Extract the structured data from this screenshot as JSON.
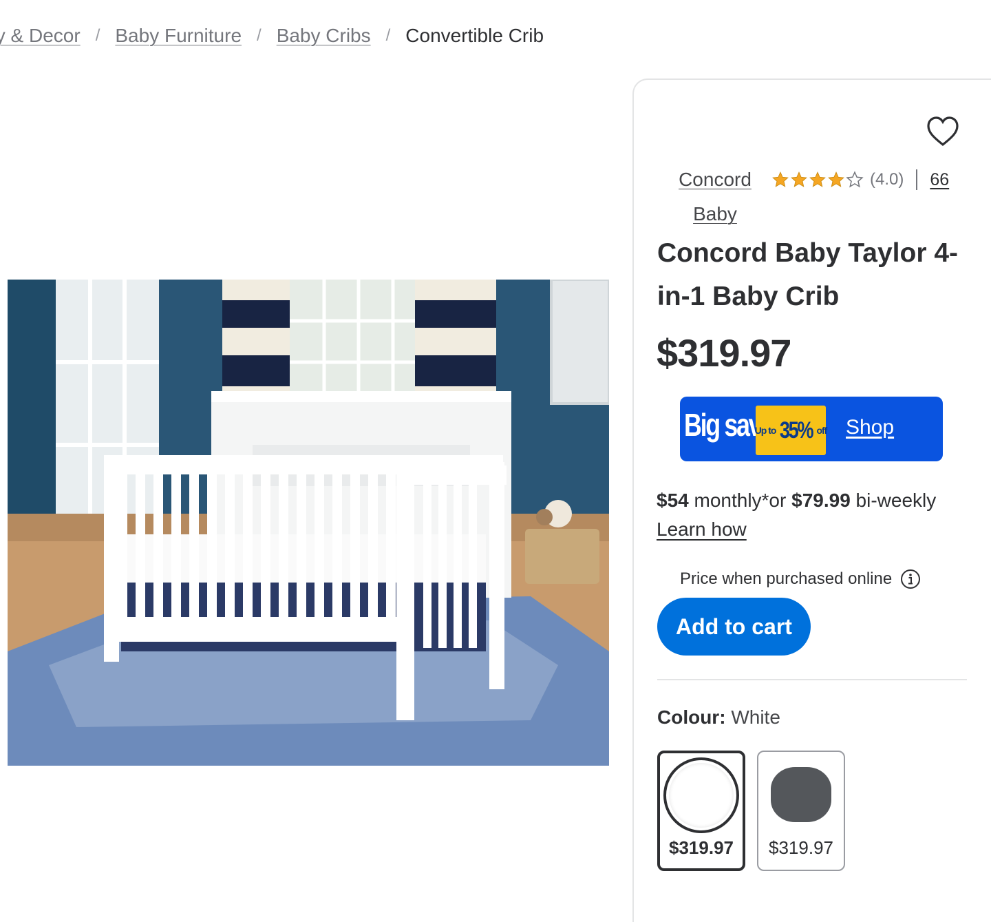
{
  "breadcrumb": {
    "items": [
      "ty & Decor",
      "Baby Furniture",
      "Baby Cribs"
    ],
    "current": "Convertible Crib",
    "separator": "/"
  },
  "product": {
    "brand": "Concord Baby",
    "rating": 4.0,
    "rating_text": "(4.0)",
    "review_count": "66",
    "title": "Concord Baby Taylor 4-in-1 Baby Crib",
    "price": "$319.97"
  },
  "promo_banner": {
    "headline": "Big save",
    "pill_small": "Up to",
    "pill_pct": "35%",
    "pill_suffix": "off",
    "cta": "Shop",
    "background": "#0a54e0",
    "pill_color": "#f7c218"
  },
  "financing": {
    "monthly_amount": "$54",
    "monthly_text": " monthly*or ",
    "biweekly_amount": "$79.99",
    "biweekly_text": " bi-weekly",
    "learn_how": "Learn how"
  },
  "price_note": "Price when purchased online",
  "add_to_cart": "Add to cart",
  "colour": {
    "label": "Colour:",
    "selected": "White",
    "options": [
      {
        "name": "White",
        "price": "$319.97",
        "swatch": "#ffffff"
      },
      {
        "name": "Grey",
        "price": "$319.97",
        "swatch": "#54575b"
      }
    ]
  },
  "colors": {
    "primary_blue": "#0071dc",
    "text": "#2e2f32",
    "star": "#f5a623"
  },
  "icons": [
    "heart-icon",
    "star-icon",
    "info-icon"
  ]
}
